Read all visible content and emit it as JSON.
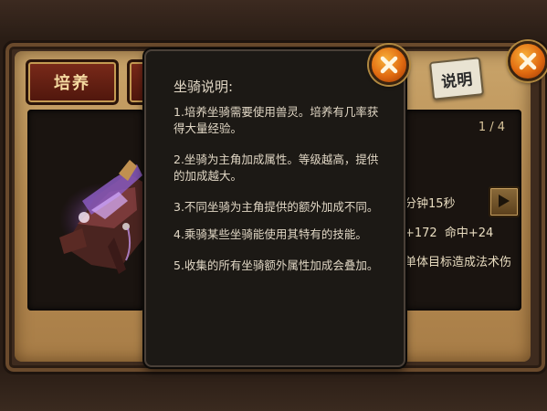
{
  "tabs": {
    "cultivate_label": "培养"
  },
  "help_badge": {
    "label": "说明"
  },
  "right_panel": {
    "page_indicator": "1 / 4",
    "time_fragment": "分钟15秒",
    "stats_fragment": "+172  命中+24",
    "skill_fragment": "单体目标造成法术伤"
  },
  "dialog": {
    "title": "坐骑说明:",
    "items": [
      "1.培养坐骑需要使用兽灵。培养有几率获得大量经验。",
      "2.坐骑为主角加成属性。等级越高，提供的加成越大。",
      "3.不同坐骑为主角提供的额外加成不同。",
      "4.乘骑某些坐骑能使用其特有的技能。",
      "5.收集的所有坐骑额外属性加成会叠加。"
    ]
  },
  "icons": {
    "close": "close-icon",
    "play": "play-arrow-icon",
    "mount": "mount-creature-image"
  },
  "colors": {
    "close_button": "#e06a10",
    "tab_button": "#7a2a1a",
    "dialog_bg": "#1c1915",
    "parchment": "#b98f55"
  }
}
